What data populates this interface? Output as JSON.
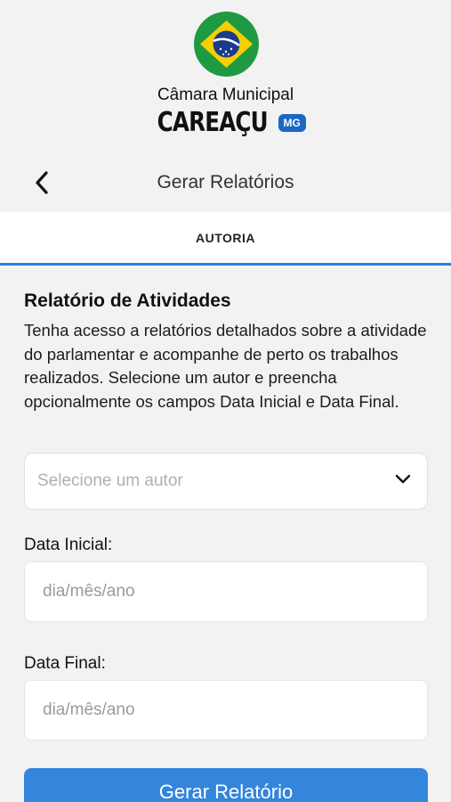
{
  "header": {
    "institution": "Câmara Municipal",
    "city": "CAREAÇU",
    "state": "MG",
    "logo": "brazil-flag-icon"
  },
  "nav": {
    "back_icon": "chevron-left-icon",
    "title": "Gerar Relatórios"
  },
  "tabs": [
    {
      "label": "AUTORIA",
      "active": true
    }
  ],
  "main": {
    "title": "Relatório de Atividades",
    "description": "Tenha acesso a relatórios detalhados sobre a atividade do parlamentar e acompanhe de perto os trabalhos realizados. Selecione um autor e preencha opcionalmente os campos Data Inicial e Data Final.",
    "author_select": {
      "placeholder": "Selecione um autor",
      "icon": "chevron-down-icon"
    },
    "start_date": {
      "label": "Data Inicial:",
      "placeholder": "dia/mês/ano",
      "value": ""
    },
    "end_date": {
      "label": "Data Final:",
      "placeholder": "dia/mês/ano",
      "value": ""
    },
    "submit_label": "Gerar Relatório"
  },
  "colors": {
    "accent": "#2f7de1",
    "button": "#3485dc",
    "badge": "#1a67c4",
    "flag_green": "#1f9a43",
    "flag_yellow": "#f5d000",
    "flag_blue": "#1d3b8c"
  }
}
